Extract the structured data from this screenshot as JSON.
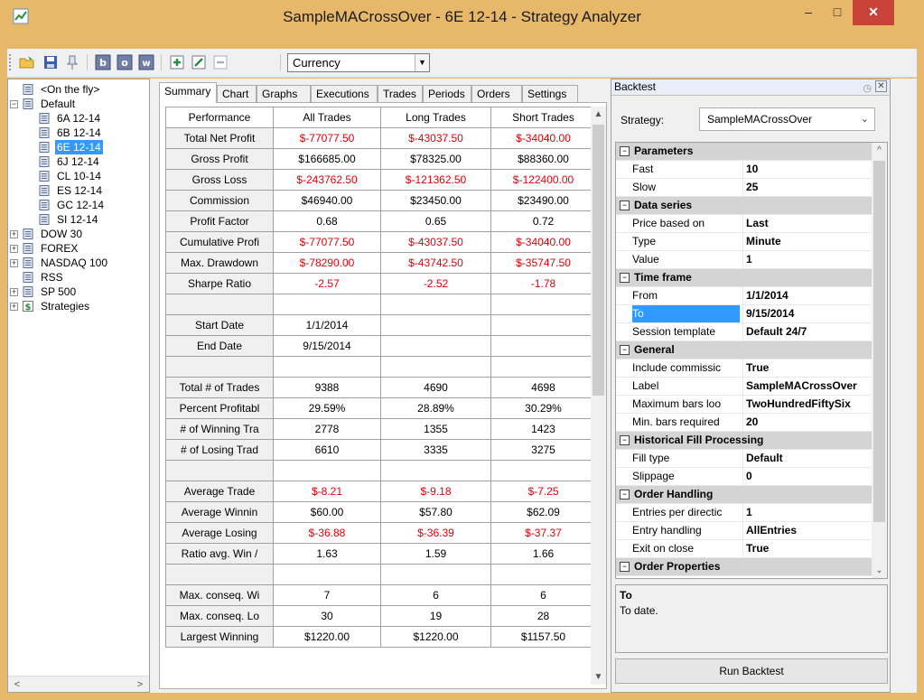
{
  "window": {
    "title": "SampleMACrossOver - 6E 12-14 - Strategy Analyzer",
    "minimize": "–",
    "maximize": "□",
    "close": "✕"
  },
  "toolbar": {
    "instrument_type": "Currency",
    "icons": [
      "open-folder-icon",
      "save-icon",
      "pin-icon",
      "b-icon",
      "o-icon",
      "w-icon",
      "add-icon",
      "edit-icon",
      "remove-icon"
    ]
  },
  "tree": {
    "items": [
      {
        "label": "<On the fly>",
        "level": 0,
        "expander": ""
      },
      {
        "label": "Default",
        "level": 0,
        "expander": "−"
      },
      {
        "label": "6A 12-14",
        "level": 1,
        "expander": ""
      },
      {
        "label": "6B 12-14",
        "level": 1,
        "expander": ""
      },
      {
        "label": "6E 12-14",
        "level": 1,
        "expander": "",
        "selected": true
      },
      {
        "label": "6J 12-14",
        "level": 1,
        "expander": ""
      },
      {
        "label": "CL 10-14",
        "level": 1,
        "expander": ""
      },
      {
        "label": "ES 12-14",
        "level": 1,
        "expander": ""
      },
      {
        "label": "GC 12-14",
        "level": 1,
        "expander": ""
      },
      {
        "label": "SI 12-14",
        "level": 1,
        "expander": ""
      },
      {
        "label": "DOW 30",
        "level": 0,
        "expander": "+"
      },
      {
        "label": "FOREX",
        "level": 0,
        "expander": "+"
      },
      {
        "label": "NASDAQ 100",
        "level": 0,
        "expander": "+"
      },
      {
        "label": "RSS",
        "level": 0,
        "expander": ""
      },
      {
        "label": "SP 500",
        "level": 0,
        "expander": "+"
      },
      {
        "label": "Strategies",
        "level": 0,
        "expander": "+",
        "icon": "strategy"
      }
    ]
  },
  "tabs": [
    "Summary",
    "Chart",
    "Graphs",
    "Executions",
    "Trades",
    "Periods",
    "Orders",
    "Settings"
  ],
  "grid": {
    "headers": [
      "Performance",
      "All Trades",
      "Long Trades",
      "Short Trades"
    ],
    "rows": [
      {
        "label": "Total Net Profit",
        "values": [
          "$-77077.50",
          "$-43037.50",
          "$-34040.00"
        ],
        "neg": true
      },
      {
        "label": "Gross Profit",
        "values": [
          "$166685.00",
          "$78325.00",
          "$88360.00"
        ],
        "neg": false
      },
      {
        "label": "Gross Loss",
        "values": [
          "$-243762.50",
          "$-121362.50",
          "$-122400.00"
        ],
        "neg": true
      },
      {
        "label": "Commission",
        "values": [
          "$46940.00",
          "$23450.00",
          "$23490.00"
        ],
        "neg": false
      },
      {
        "label": "Profit Factor",
        "values": [
          "0.68",
          "0.65",
          "0.72"
        ],
        "neg": false
      },
      {
        "label": "Cumulative Profi",
        "values": [
          "$-77077.50",
          "$-43037.50",
          "$-34040.00"
        ],
        "neg": true
      },
      {
        "label": "Max. Drawdown",
        "values": [
          "$-78290.00",
          "$-43742.50",
          "$-35747.50"
        ],
        "neg": true
      },
      {
        "label": "Sharpe Ratio",
        "values": [
          "-2.57",
          "-2.52",
          "-1.78"
        ],
        "neg": true
      },
      {
        "label": "",
        "values": [
          "",
          "",
          ""
        ],
        "neg": false
      },
      {
        "label": "Start Date",
        "values": [
          "1/1/2014",
          "",
          ""
        ],
        "neg": false
      },
      {
        "label": "End Date",
        "values": [
          "9/15/2014",
          "",
          ""
        ],
        "neg": false
      },
      {
        "label": "",
        "values": [
          "",
          "",
          ""
        ],
        "neg": false
      },
      {
        "label": "Total # of Trades",
        "values": [
          "9388",
          "4690",
          "4698"
        ],
        "neg": false
      },
      {
        "label": "Percent Profitabl",
        "values": [
          "29.59%",
          "28.89%",
          "30.29%"
        ],
        "neg": false
      },
      {
        "label": "# of Winning Tra",
        "values": [
          "2778",
          "1355",
          "1423"
        ],
        "neg": false
      },
      {
        "label": "# of Losing Trad",
        "values": [
          "6610",
          "3335",
          "3275"
        ],
        "neg": false
      },
      {
        "label": "",
        "values": [
          "",
          "",
          ""
        ],
        "neg": false
      },
      {
        "label": "Average Trade",
        "values": [
          "$-8.21",
          "$-9.18",
          "$-7.25"
        ],
        "neg": true
      },
      {
        "label": "Average Winnin",
        "values": [
          "$60.00",
          "$57.80",
          "$62.09"
        ],
        "neg": false
      },
      {
        "label": "Average Losing",
        "values": [
          "$-36.88",
          "$-36.39",
          "$-37.37"
        ],
        "neg": true
      },
      {
        "label": "Ratio avg. Win /",
        "values": [
          "1.63",
          "1.59",
          "1.66"
        ],
        "neg": false
      },
      {
        "label": "",
        "values": [
          "",
          "",
          ""
        ],
        "neg": false
      },
      {
        "label": "Max. conseq. Wi",
        "values": [
          "7",
          "6",
          "6"
        ],
        "neg": false
      },
      {
        "label": "Max. conseq. Lo",
        "values": [
          "30",
          "19",
          "28"
        ],
        "neg": false
      },
      {
        "label": "Largest Winning",
        "values": [
          "$1220.00",
          "$1220.00",
          "$1157.50"
        ],
        "neg": false
      }
    ]
  },
  "backtest": {
    "panel_title": "Backtest",
    "strategy_label": "Strategy:",
    "strategy_value": "SampleMACrossOver",
    "properties": [
      {
        "type": "cat",
        "name": "Parameters"
      },
      {
        "type": "prop",
        "name": "Fast",
        "value": "10"
      },
      {
        "type": "prop",
        "name": "Slow",
        "value": "25"
      },
      {
        "type": "cat",
        "name": "Data series"
      },
      {
        "type": "prop",
        "name": "Price based on",
        "value": "Last"
      },
      {
        "type": "prop",
        "name": "Type",
        "value": "Minute"
      },
      {
        "type": "prop",
        "name": "Value",
        "value": "1"
      },
      {
        "type": "cat",
        "name": "Time frame"
      },
      {
        "type": "prop",
        "name": "From",
        "value": "1/1/2014"
      },
      {
        "type": "prop",
        "name": "To",
        "value": "9/15/2014",
        "selected": true
      },
      {
        "type": "prop",
        "name": "Session template",
        "value": "Default 24/7"
      },
      {
        "type": "cat",
        "name": "General"
      },
      {
        "type": "prop",
        "name": "Include commissic",
        "value": "True"
      },
      {
        "type": "prop",
        "name": "Label",
        "value": "SampleMACrossOver"
      },
      {
        "type": "prop",
        "name": "Maximum bars loo",
        "value": "TwoHundredFiftySix"
      },
      {
        "type": "prop",
        "name": "Min. bars required",
        "value": "20"
      },
      {
        "type": "cat",
        "name": "Historical Fill Processing"
      },
      {
        "type": "prop",
        "name": "Fill type",
        "value": "Default"
      },
      {
        "type": "prop",
        "name": "Slippage",
        "value": "0"
      },
      {
        "type": "cat",
        "name": "Order Handling"
      },
      {
        "type": "prop",
        "name": "Entries per directic",
        "value": "1"
      },
      {
        "type": "prop",
        "name": "Entry handling",
        "value": "AllEntries"
      },
      {
        "type": "prop",
        "name": "Exit on close",
        "value": "True"
      },
      {
        "type": "cat",
        "name": "Order Properties"
      }
    ],
    "help_title": "To",
    "help_text": "To date.",
    "run_button": "Run Backtest"
  },
  "colors": {
    "window_frame": "#e8b86a",
    "negative": "#e0000a",
    "selection": "#3399ff",
    "close_button": "#c8423a"
  }
}
